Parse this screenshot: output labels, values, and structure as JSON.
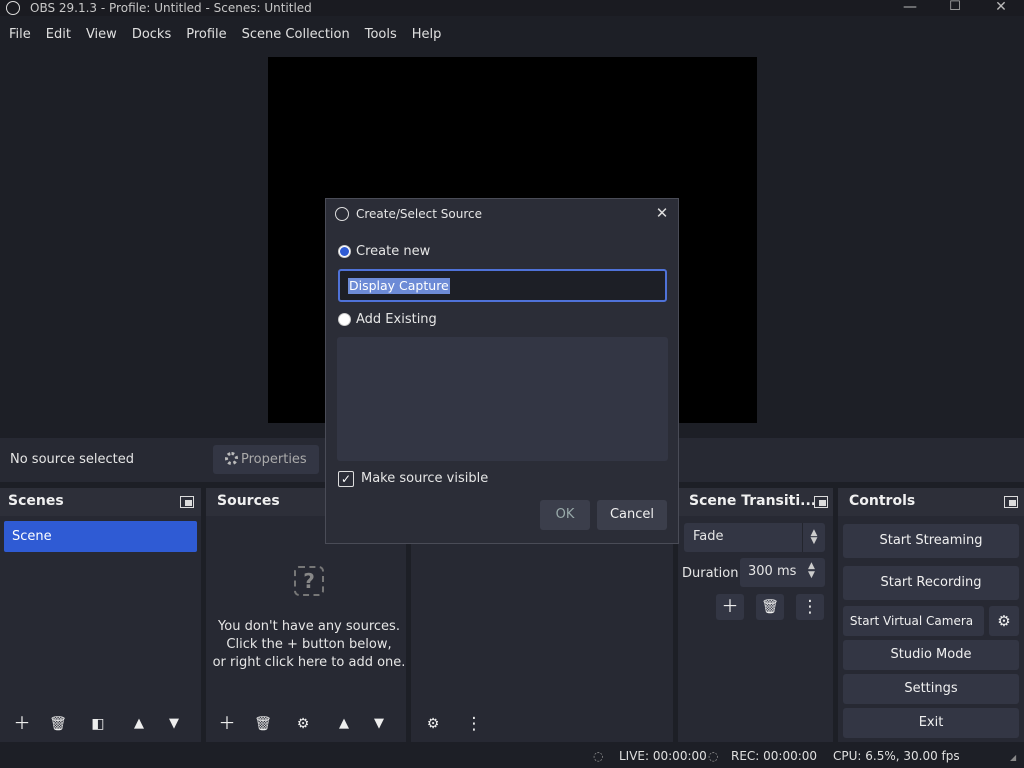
{
  "window": {
    "title": "OBS 29.1.3 - Profile: Untitled - Scenes: Untitled",
    "minimize": "—",
    "maximize": "☐",
    "close": "✕"
  },
  "menu": [
    "File",
    "Edit",
    "View",
    "Docks",
    "Profile",
    "Scene Collection",
    "Tools",
    "Help"
  ],
  "context_bar": {
    "no_source": "No source selected",
    "properties": "Properties"
  },
  "docks": {
    "scenes": {
      "title": "Scenes",
      "items": [
        "Scene"
      ]
    },
    "sources": {
      "title": "Sources",
      "empty_line1": "You don't have any sources.",
      "empty_line2": "Click the + button below,",
      "empty_line3": "or right click here to add one."
    },
    "transitions": {
      "title": "Scene Transiti...",
      "selected": "Fade",
      "duration_label": "Duration",
      "duration_value": "300 ms"
    },
    "controls": {
      "title": "Controls",
      "start_streaming": "Start Streaming",
      "start_recording": "Start Recording",
      "start_virtual_camera": "Start Virtual Camera",
      "studio_mode": "Studio Mode",
      "settings": "Settings",
      "exit": "Exit"
    }
  },
  "status": {
    "live": "LIVE: 00:00:00",
    "rec": "REC: 00:00:00",
    "cpu": "CPU: 6.5%, 30.00 fps"
  },
  "dialog": {
    "title": "Create/Select Source",
    "create_new": "Create new",
    "name_value": "Display Capture",
    "add_existing": "Add Existing",
    "make_visible": "Make source visible",
    "ok": "OK",
    "cancel": "Cancel"
  }
}
